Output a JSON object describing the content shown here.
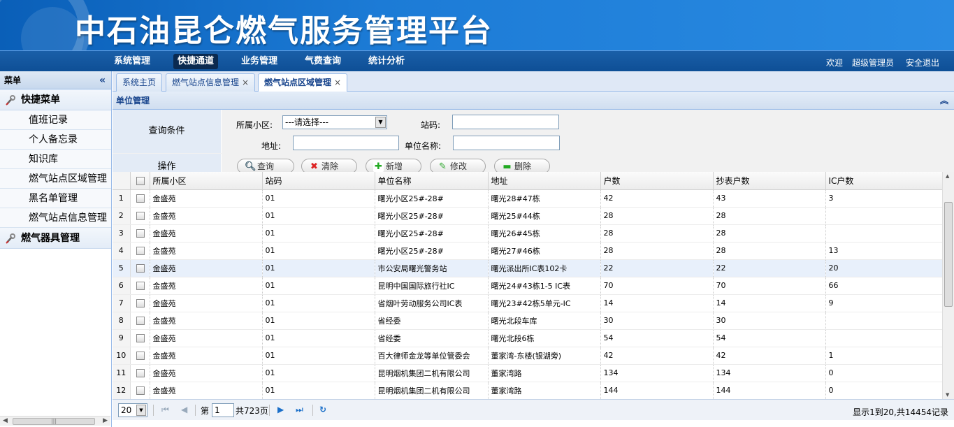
{
  "header": {
    "title": "中石油昆仑燃气服务管理平台"
  },
  "nav": {
    "items": [
      "系统管理",
      "快捷通道",
      "业务管理",
      "气费查询",
      "统计分析"
    ],
    "active_index": 1,
    "welcome": "欢迎",
    "user": "超级管理员",
    "logout": "安全退出"
  },
  "sidebar": {
    "title": "菜单",
    "collapse": "«",
    "group1": "快捷菜单",
    "items": [
      "值班记录",
      "个人备忘录",
      "知识库",
      "燃气站点区域管理",
      "黑名单管理",
      "燃气站点信息管理"
    ],
    "group2": "燃气器具管理"
  },
  "tabs": [
    {
      "label": "系统主页"
    },
    {
      "label": "燃气站点信息管理",
      "close": "×"
    },
    {
      "label": "燃气站点区域管理",
      "close": "×"
    }
  ],
  "panel": {
    "title": "单位管理",
    "collapse": "︽"
  },
  "query": {
    "label": "查询条件",
    "ops_label": "操作",
    "community_label": "所属小区:",
    "community_value": "---请选择---",
    "station_label": "站码:",
    "station_value": "",
    "address_label": "地址:",
    "address_value": "",
    "unit_label": "单位名称:",
    "unit_value": ""
  },
  "buttons": {
    "query": "查询",
    "clear": "清除",
    "add": "新增",
    "edit": "修改",
    "delete": "删除"
  },
  "table": {
    "columns": [
      "所属小区",
      "站码",
      "单位名称",
      "地址",
      "户数",
      "抄表户数",
      "IC户数"
    ],
    "rows": [
      [
        "1",
        "金盛苑",
        "01",
        "曙光小区25#-28#",
        "曙光28#47栋",
        "42",
        "43",
        "3"
      ],
      [
        "2",
        "金盛苑",
        "01",
        "曙光小区25#-28#",
        "曙光25#44栋",
        "28",
        "28",
        ""
      ],
      [
        "3",
        "金盛苑",
        "01",
        "曙光小区25#-28#",
        "曙光26#45栋",
        "28",
        "28",
        ""
      ],
      [
        "4",
        "金盛苑",
        "01",
        "曙光小区25#-28#",
        "曙光27#46栋",
        "28",
        "28",
        "13"
      ],
      [
        "5",
        "金盛苑",
        "01",
        "市公安局曙光警务站",
        "曙光派出所IC表102卡",
        "22",
        "22",
        "20"
      ],
      [
        "6",
        "金盛苑",
        "01",
        "昆明中国国际旅行社IC",
        "曙光24#43栋1-5 IC表",
        "70",
        "70",
        "66"
      ],
      [
        "7",
        "金盛苑",
        "01",
        "省烟叶劳动服务公司IC表",
        "曙光23#42栋5单元-IC",
        "14",
        "14",
        "9"
      ],
      [
        "8",
        "金盛苑",
        "01",
        "省经委",
        "曙光北段车库",
        "30",
        "30",
        ""
      ],
      [
        "9",
        "金盛苑",
        "01",
        "省经委",
        "曙光北段6栋",
        "54",
        "54",
        ""
      ],
      [
        "10",
        "金盛苑",
        "01",
        "百大律师金龙等单位管委会",
        "董家湾-东楼(银湖旁)",
        "42",
        "42",
        "1"
      ],
      [
        "11",
        "金盛苑",
        "01",
        "昆明烟机集团二机有限公司",
        "董家湾路",
        "134",
        "134",
        "0"
      ],
      [
        "12",
        "金盛苑",
        "01",
        "昆明烟机集团二机有限公司",
        "董家湾路",
        "144",
        "144",
        "0"
      ]
    ],
    "highlight_row": 5
  },
  "pager": {
    "page_size": "20",
    "page_prefix": "第",
    "page_value": "1",
    "page_total": "共723页",
    "summary": "显示1到20,共14454记录"
  }
}
